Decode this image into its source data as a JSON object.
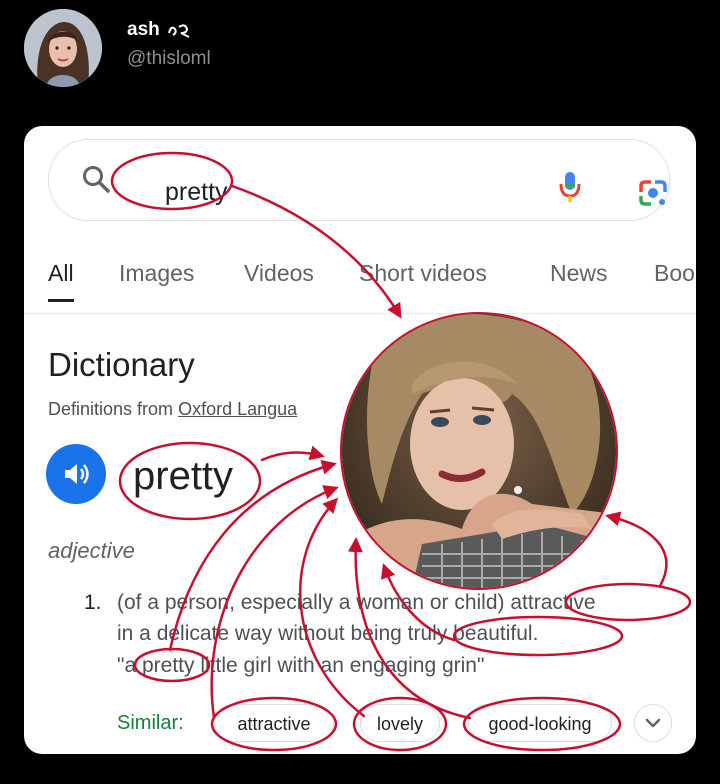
{
  "tweet": {
    "display_name": "ash",
    "handle": "@thisloml"
  },
  "search": {
    "query": "pretty"
  },
  "tabs": [
    {
      "label": "All"
    },
    {
      "label": "Images"
    },
    {
      "label": "Videos"
    },
    {
      "label": "Short videos"
    },
    {
      "label": "News"
    },
    {
      "label": "Boo"
    }
  ],
  "dictionary": {
    "title": "Dictionary",
    "source_prefix": "Definitions from",
    "source_link": "Oxford Langua",
    "word": "pretty",
    "part_of_speech": "adjective",
    "definition_number": "1.",
    "definition_line1": "(of a person, especially a woman or child) attractive",
    "definition_line2": "in a delicate way without being truly beautiful.",
    "example": "\"a pretty little girl with an engaging grin\"",
    "similar_label": "Similar:",
    "similar": [
      "attractive",
      "lovely",
      "good-looking"
    ]
  },
  "colors": {
    "annotation_red": "#c8102e",
    "google_blue": "#1a73e8",
    "similar_green": "#188038"
  },
  "icons": [
    "avatar",
    "search-icon",
    "microphone-icon",
    "google-lens-icon",
    "speaker-icon",
    "chevron-down-icon"
  ]
}
